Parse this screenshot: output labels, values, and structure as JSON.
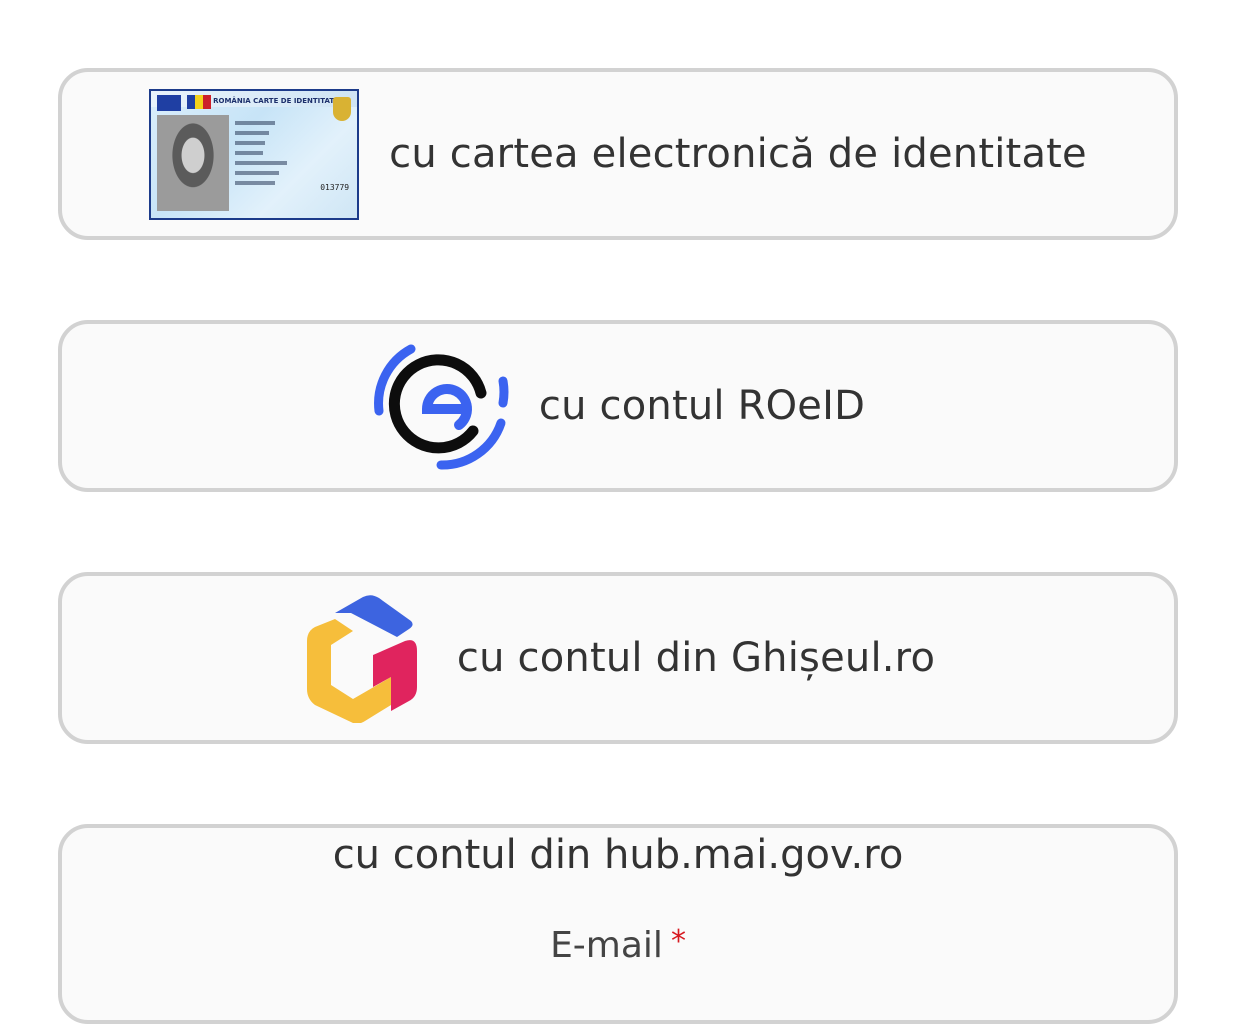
{
  "login_options": [
    {
      "label": "cu cartea electronică de identitate",
      "icon": "id-card-icon",
      "card": {
        "header": "ROMÂNIA   CARTE DE IDENTITATE",
        "number": "013779"
      }
    },
    {
      "label": "cu contul ROeID",
      "icon": "roeid-logo-icon"
    },
    {
      "label": "cu contul din Ghișeul.ro",
      "icon": "ghiseul-logo-icon"
    }
  ],
  "hub_login": {
    "title": "cu contul din hub.mai.gov.ro",
    "email_label": "E-mail",
    "required_marker": "*"
  },
  "colors": {
    "card_border": "#d2d2d2",
    "card_background": "#fafafa",
    "text": "#333333",
    "roeid_blue": "#3b63f0",
    "roeid_black": "#0d0d0d",
    "ghiseul_blue": "#3d64e0",
    "ghiseul_yellow": "#f6be3b",
    "ghiseul_red": "#e0245e",
    "required_red": "#d71920"
  }
}
